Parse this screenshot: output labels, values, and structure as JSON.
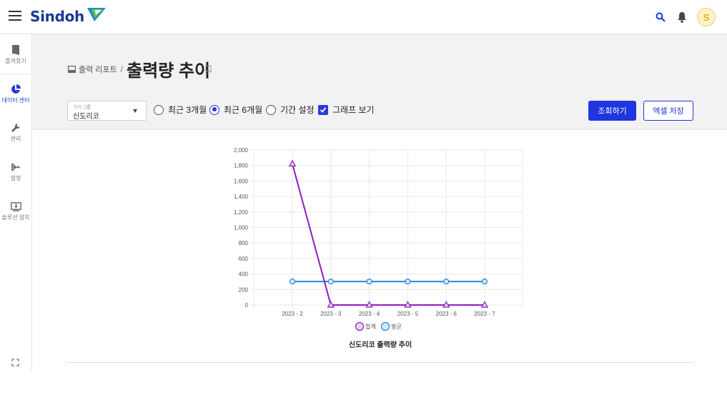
{
  "app": {
    "logo_text": "Sindoh",
    "avatar_initial": "S"
  },
  "topbar": {
    "icons": [
      "menu-icon",
      "search-icon",
      "bell-icon"
    ]
  },
  "sidebar": {
    "items": [
      {
        "label": "즐겨찾기",
        "icon": "bookmark-icon",
        "active": false
      },
      {
        "label": "데이터 센터",
        "icon": "pie-chart-icon",
        "active": true
      },
      {
        "label": "관리",
        "icon": "wrench-icon",
        "active": false
      },
      {
        "label": "설정",
        "icon": "settings-flow-icon",
        "active": false
      },
      {
        "label": "솔루션 설치",
        "icon": "install-icon",
        "active": false
      }
    ],
    "bottom_icon": "fullscreen-icon"
  },
  "header": {
    "breadcrumb_parent": "출력 리포트",
    "breadcrumb_sep": "/",
    "title": "출력량 추이"
  },
  "filters": {
    "device_group": {
      "label": "기기 그룹",
      "value": "신도리코"
    },
    "options": [
      {
        "label": "최근 3개월",
        "type": "radio",
        "checked": false
      },
      {
        "label": "최근 6개월",
        "type": "radio",
        "checked": true
      },
      {
        "label": "기간 설정",
        "type": "radio",
        "checked": false
      },
      {
        "label": "그래프 보기",
        "type": "checkbox",
        "checked": true
      }
    ],
    "search_button": "조회하기",
    "excel_button": "엑셀 저장"
  },
  "colors": {
    "accent": "#1f35e0",
    "series_total": "#8e1cc2",
    "series_avg": "#2a85d6"
  },
  "chart_data": {
    "type": "line",
    "title": "신도리코 출력량 추이",
    "categories": [
      "2023 - 2",
      "2023 - 3",
      "2023 - 4",
      "2023 - 5",
      "2023 - 6",
      "2023 - 7"
    ],
    "series": [
      {
        "name": "합계",
        "values": [
          1820,
          0,
          0,
          0,
          0,
          0
        ],
        "color": "#8e1cc2",
        "marker": "triangle"
      },
      {
        "name": "평균",
        "values": [
          303,
          303,
          303,
          303,
          303,
          303
        ],
        "color": "#2a85d6",
        "marker": "circle"
      }
    ],
    "yticks": [
      "0",
      "200",
      "400",
      "600",
      "800",
      "1,000",
      "1,200",
      "1,400",
      "1,600",
      "1,800",
      "2,000"
    ],
    "ylim": [
      0,
      2000
    ],
    "grid": true,
    "legend_position": "bottom"
  }
}
